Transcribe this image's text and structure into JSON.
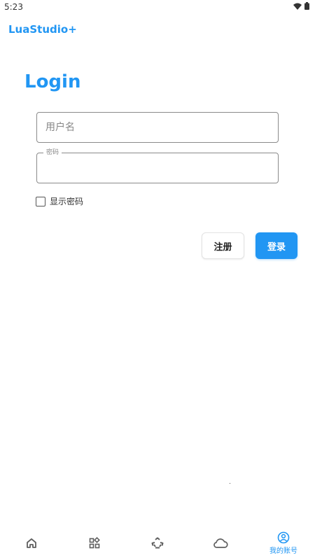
{
  "status_bar": {
    "time": "5:23",
    "icons": [
      "wifi-icon",
      "battery-icon"
    ]
  },
  "app_bar": {
    "title": "LuaStudio+"
  },
  "login": {
    "title": "Login",
    "username_placeholder": "用户名",
    "password_label": "密码",
    "password_value": "",
    "show_password_label": "显示密码",
    "show_password_checked": false,
    "register_label": "注册",
    "login_label": "登录"
  },
  "bottom_nav": {
    "items": [
      {
        "icon": "home-icon",
        "label": ""
      },
      {
        "icon": "apps-icon",
        "label": ""
      },
      {
        "icon": "recycle-icon",
        "label": ""
      },
      {
        "icon": "cloud-icon",
        "label": ""
      },
      {
        "icon": "account-icon",
        "label": "我的账号",
        "active": true
      }
    ]
  },
  "colors": {
    "accent": "#2196F3",
    "inactive_icon": "#5f5f5f",
    "border": "#8a8a8a"
  }
}
